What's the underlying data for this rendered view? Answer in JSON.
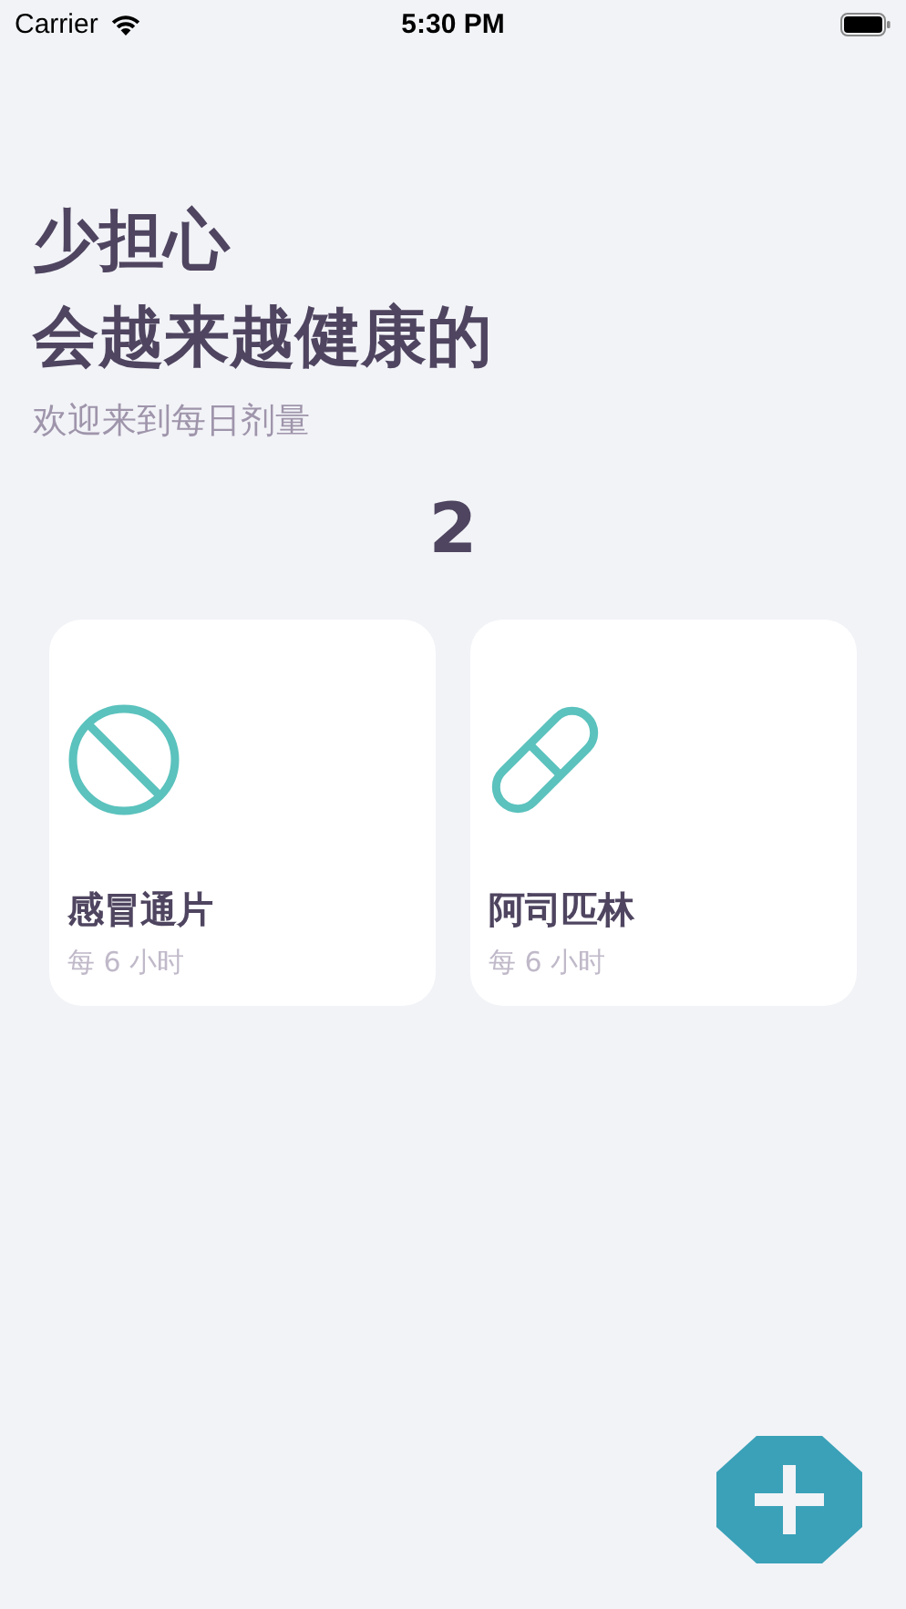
{
  "status_bar": {
    "carrier": "Carrier",
    "time": "5:30 PM"
  },
  "header": {
    "title_lines": [
      "少担心",
      "会越来越健康的"
    ],
    "subtitle": "欢迎来到每日剂量"
  },
  "count": "2",
  "medicines": [
    {
      "kind": "blocked",
      "name": "感冒通片",
      "schedule": "每 6 小时"
    },
    {
      "kind": "capsule",
      "name": "阿司匹林",
      "schedule": "每 6 小时"
    }
  ]
}
